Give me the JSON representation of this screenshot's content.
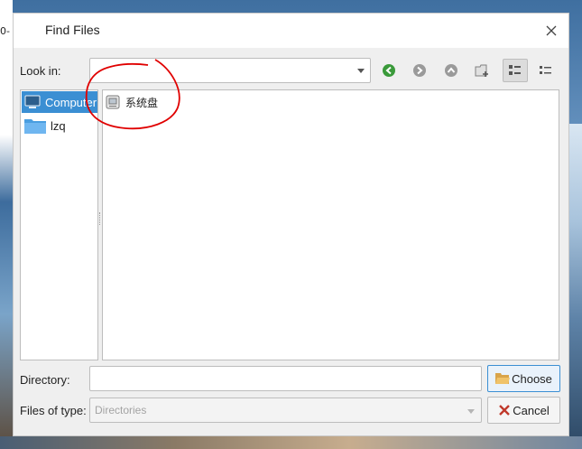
{
  "desktop": {
    "edge_text": "0-"
  },
  "dialog": {
    "title": "Find Files",
    "look_in_label": "Look in:",
    "look_in_value": "",
    "toolbar": [
      "back-icon",
      "forward-icon",
      "up-icon",
      "new-folder-icon",
      "list-view-icon",
      "detail-view-icon"
    ],
    "sidebar": [
      {
        "label": "Computer",
        "icon": "computer-icon",
        "selected": true
      },
      {
        "label": "lzq",
        "icon": "folder-icon",
        "selected": false
      }
    ],
    "files": [
      {
        "label": "系统盘",
        "icon": "drive-icon"
      }
    ],
    "directory_label": "Directory:",
    "directory_value": "",
    "choose_label": "Choose",
    "filetype_label": "Files of type:",
    "filetype_placeholder": "Directories",
    "cancel_label": "Cancel"
  },
  "colors": {
    "selection": "#3b8fd3",
    "annotation": "#e00000"
  }
}
